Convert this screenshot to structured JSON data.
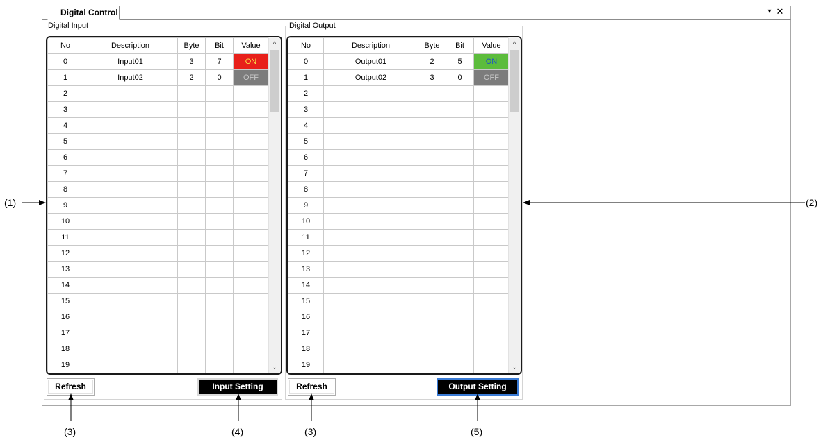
{
  "tab": {
    "title": "Digital Control",
    "menu_icon": "dropdown-arrow-icon",
    "close_icon": "close-icon"
  },
  "input_panel": {
    "legend": "Digital Input",
    "columns": [
      "No",
      "Description",
      "Byte",
      "Bit",
      "Value"
    ],
    "rows": [
      {
        "no": "0",
        "description": "Input01",
        "byte": "3",
        "bit": "7",
        "value": "ON",
        "state": "on-red"
      },
      {
        "no": "1",
        "description": "Input02",
        "byte": "2",
        "bit": "0",
        "value": "OFF",
        "state": "off"
      },
      {
        "no": "2"
      },
      {
        "no": "3"
      },
      {
        "no": "4"
      },
      {
        "no": "5"
      },
      {
        "no": "6"
      },
      {
        "no": "7"
      },
      {
        "no": "8"
      },
      {
        "no": "9"
      },
      {
        "no": "10"
      },
      {
        "no": "11"
      },
      {
        "no": "12"
      },
      {
        "no": "13"
      },
      {
        "no": "14"
      },
      {
        "no": "15"
      },
      {
        "no": "16"
      },
      {
        "no": "17"
      },
      {
        "no": "18"
      },
      {
        "no": "19"
      }
    ],
    "refresh_label": "Refresh",
    "setting_label": "Input Setting"
  },
  "output_panel": {
    "legend": "Digital Output",
    "columns": [
      "No",
      "Description",
      "Byte",
      "Bit",
      "Value"
    ],
    "rows": [
      {
        "no": "0",
        "description": "Output01",
        "byte": "2",
        "bit": "5",
        "value": "ON",
        "state": "on-green"
      },
      {
        "no": "1",
        "description": "Output02",
        "byte": "3",
        "bit": "0",
        "value": "OFF",
        "state": "off"
      },
      {
        "no": "2"
      },
      {
        "no": "3"
      },
      {
        "no": "4"
      },
      {
        "no": "5"
      },
      {
        "no": "6"
      },
      {
        "no": "7"
      },
      {
        "no": "8"
      },
      {
        "no": "9"
      },
      {
        "no": "10"
      },
      {
        "no": "11"
      },
      {
        "no": "12"
      },
      {
        "no": "13"
      },
      {
        "no": "14"
      },
      {
        "no": "15"
      },
      {
        "no": "16"
      },
      {
        "no": "17"
      },
      {
        "no": "18"
      },
      {
        "no": "19"
      }
    ],
    "refresh_label": "Refresh",
    "setting_label": "Output Setting"
  },
  "callouts": {
    "c1": "(1)",
    "c2": "(2)",
    "c3a": "(3)",
    "c3b": "(3)",
    "c4": "(4)",
    "c5": "(5)"
  },
  "colors": {
    "on_red": "#e8201a",
    "on_red_text": "#f7e24a",
    "on_green": "#5cbc3c",
    "on_green_text": "#1e50c8",
    "off": "#7c7c7c",
    "off_text": "#c8c8c8",
    "focus_border": "#3a7bd5"
  },
  "scrollbar_icons": {
    "up": "scroll-up-arrow-icon",
    "down": "scroll-down-arrow-icon"
  }
}
